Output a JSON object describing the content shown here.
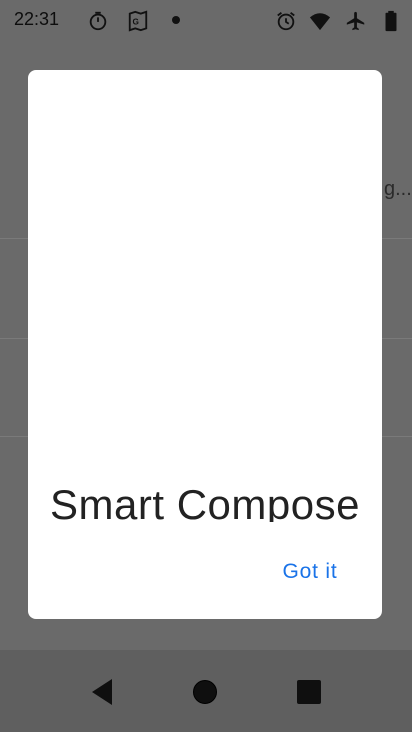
{
  "status_bar": {
    "time": "22:31",
    "left_icons": [
      "timer-icon",
      "maps-icon",
      "notification-dot-icon"
    ],
    "right_icons": [
      "alarm-icon",
      "wifi-icon",
      "airplane-mode-icon",
      "battery-icon"
    ]
  },
  "background": {
    "peek_text": "g..."
  },
  "dialog": {
    "title": "Smart Compose",
    "button_label": "Got it",
    "accent_color": "#1a73e8"
  },
  "nav_bar": {
    "buttons": [
      "back-icon",
      "home-icon",
      "recents-icon"
    ]
  }
}
